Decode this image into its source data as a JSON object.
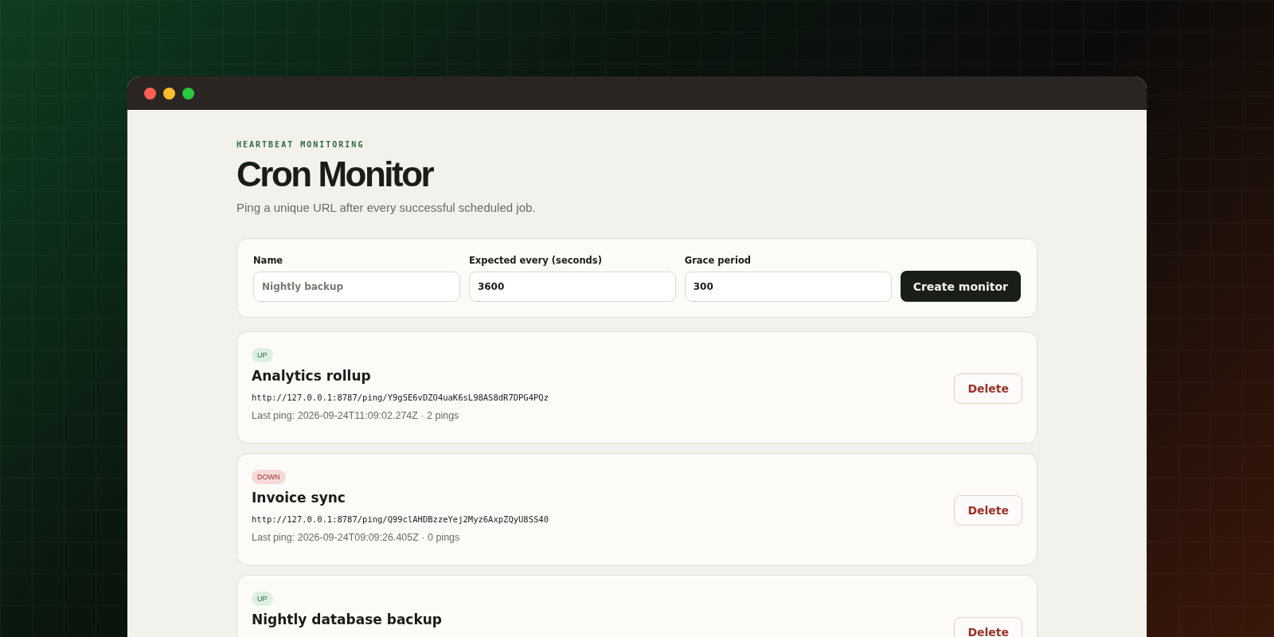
{
  "header": {
    "eyebrow": "HEARTBEAT MONITORING",
    "title": "Cron Monitor",
    "subtitle": "Ping a unique URL after every successful scheduled job."
  },
  "form": {
    "fields": [
      {
        "label": "Name",
        "placeholder": "Nightly backup"
      },
      {
        "label": "Expected every (seconds)",
        "value": "3600"
      },
      {
        "label": "Grace period",
        "value": "300"
      }
    ],
    "submit": "Create monitor"
  },
  "monitors": [
    {
      "status": {
        "label": "UP",
        "kind": "up"
      },
      "name": "Analytics rollup",
      "url": "http://127.0.0.1:8787/ping/Y9gSE6vDZO4uaK6sL98AS8dR7DPG4PQz",
      "meta": "Last ping: 2026-09-24T11:09:02.274Z · 2 pings",
      "action": "Delete"
    },
    {
      "status": {
        "label": "DOWN",
        "kind": "down"
      },
      "name": "Invoice sync",
      "url": "http://127.0.0.1:8787/ping/Q99clAHDBzzeYej2Myz6AxpZQyU8SS40",
      "meta": "Last ping: 2026-09-24T09:09:26.405Z · 0 pings",
      "action": "Delete"
    },
    {
      "status": {
        "label": "UP",
        "kind": "up"
      },
      "name": "Nightly database backup",
      "action": "Delete"
    }
  ]
}
